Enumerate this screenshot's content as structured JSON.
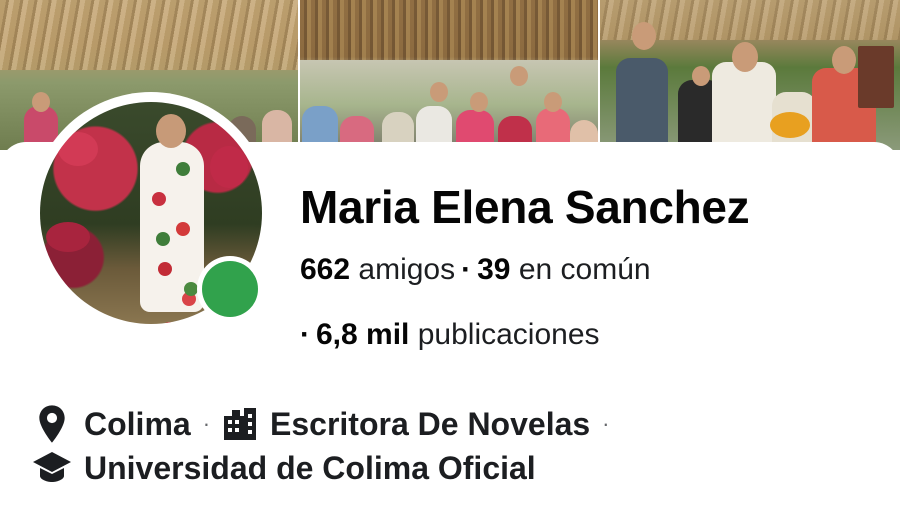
{
  "profile": {
    "name": "Maria Elena Sanchez",
    "friends_count": "662",
    "friends_label": "amigos",
    "mutual_count": "39",
    "mutual_label": "en común",
    "posts_count": "6,8 mil",
    "posts_label": "publicaciones",
    "online": true
  },
  "details": {
    "location": "Colima",
    "work": "Escritora De Novelas",
    "education": "Universidad de Colima Oficial",
    "location_icon": "location-pin-icon",
    "work_icon": "work-building-icon",
    "education_icon": "graduation-cap-icon",
    "separator": "·"
  },
  "colors": {
    "online_indicator": "#31a24c",
    "text_primary": "#050505",
    "text_secondary": "#65676b"
  }
}
